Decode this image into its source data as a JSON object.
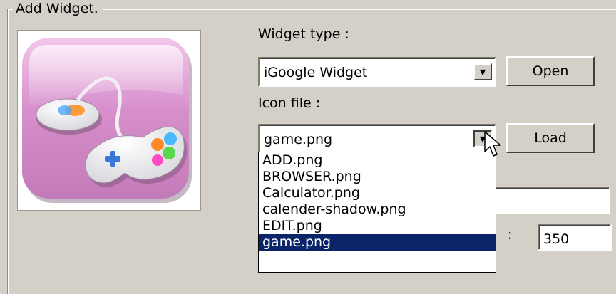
{
  "group": {
    "title": "Add Widget."
  },
  "widget_type": {
    "label": "Widget type :",
    "selected": "iGoogle Widget",
    "open_label": "Open"
  },
  "icon_file": {
    "label": "Icon file :",
    "selected": "game.png",
    "load_label": "Load",
    "options": [
      "ADD.png",
      "BROWSER.png",
      "Calculator.png",
      "calender-shadow.png",
      "EDIT.png",
      "game.png"
    ],
    "highlighted_index": 5
  },
  "partial_field": {
    "colon": ":",
    "value": "350"
  }
}
